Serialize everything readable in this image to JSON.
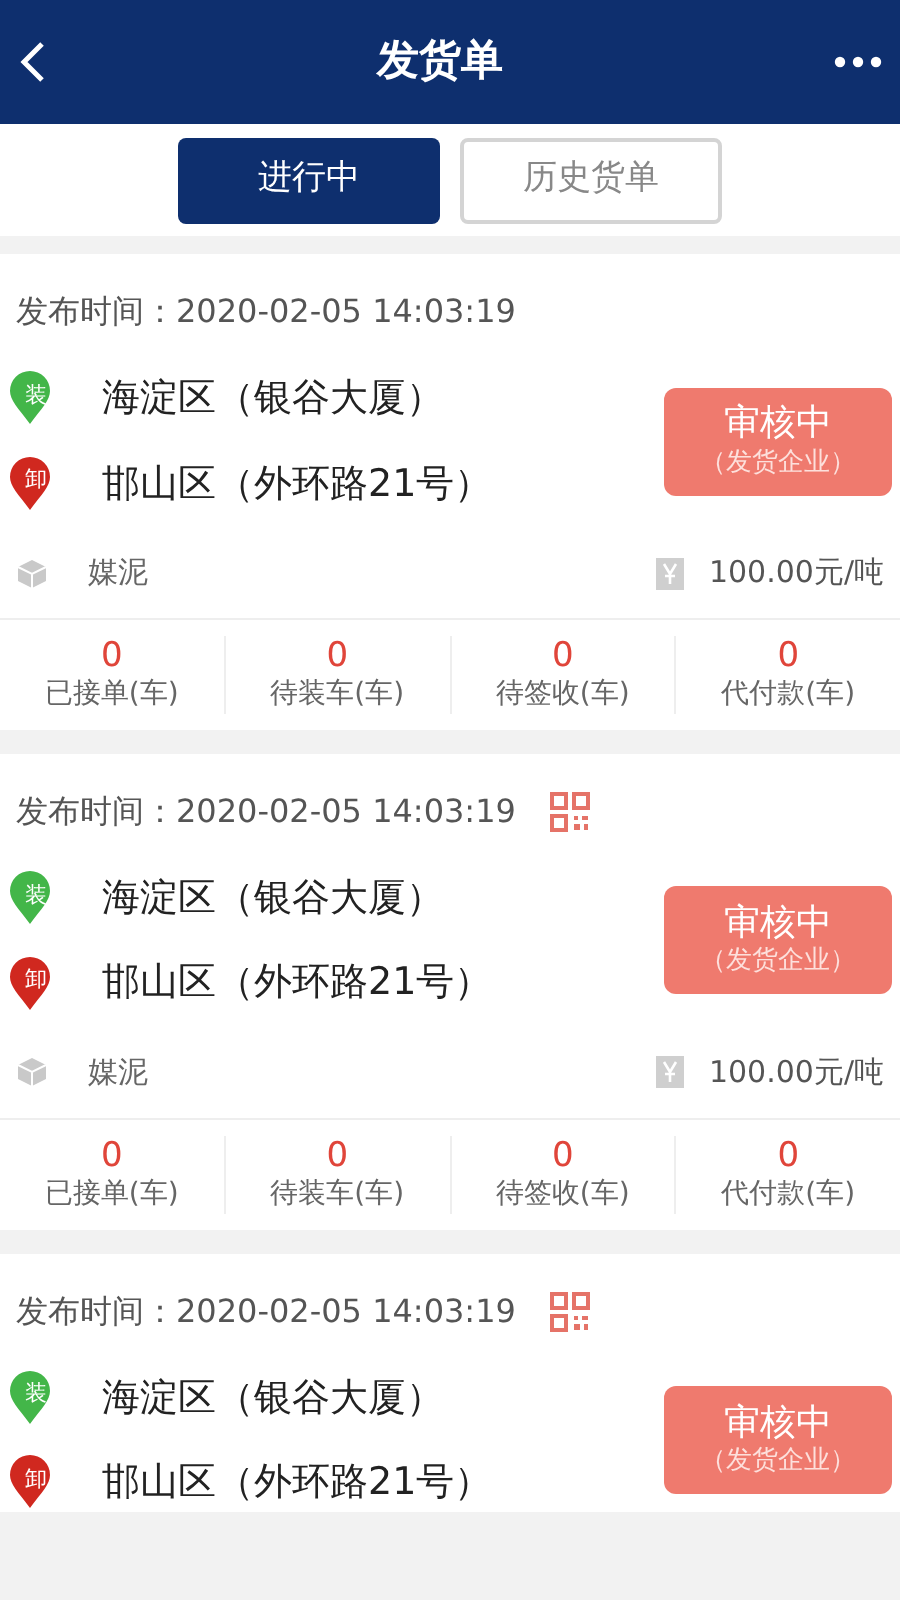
{
  "header": {
    "title": "发货单"
  },
  "tabs": [
    {
      "label": "进行中",
      "selected": true
    },
    {
      "label": "历史货单",
      "selected": false
    }
  ],
  "orders": [
    {
      "time_label": "发布时间：",
      "time": "2020-02-05 14:03:19",
      "qr": false,
      "stops": [
        {
          "pin": "装",
          "color": "#43b649",
          "address": "海淀区（银谷大厦）"
        },
        {
          "pin": "卸",
          "color": "#d0281f",
          "address": "邯山区（外环路21号）"
        }
      ],
      "status": {
        "title": "审核中",
        "subtitle": "（发货企业）"
      },
      "cargo": "媒泥",
      "price": "100.00元/吨",
      "stats": [
        {
          "value": "0",
          "label": "已接单(车)"
        },
        {
          "value": "0",
          "label": "待装车(车)"
        },
        {
          "value": "0",
          "label": "待签收(车)"
        },
        {
          "value": "0",
          "label": "代付款(车)"
        }
      ]
    },
    {
      "time_label": "发布时间：",
      "time": "2020-02-05 14:03:19",
      "qr": true,
      "stops": [
        {
          "pin": "装",
          "color": "#43b649",
          "address": "海淀区（银谷大厦）"
        },
        {
          "pin": "卸",
          "color": "#d0281f",
          "address": "邯山区（外环路21号）"
        }
      ],
      "status": {
        "title": "审核中",
        "subtitle": "（发货企业）"
      },
      "cargo": "媒泥",
      "price": "100.00元/吨",
      "stats": [
        {
          "value": "0",
          "label": "已接单(车)"
        },
        {
          "value": "0",
          "label": "待装车(车)"
        },
        {
          "value": "0",
          "label": "待签收(车)"
        },
        {
          "value": "0",
          "label": "代付款(车)"
        }
      ]
    },
    {
      "time_label": "发布时间：",
      "time": "2020-02-05 14:03:19",
      "qr": true,
      "stops": [
        {
          "pin": "装",
          "color": "#43b649",
          "address": "海淀区（银谷大厦）"
        },
        {
          "pin": "卸",
          "color": "#d0281f",
          "address": "邯山区（外环路21号）"
        }
      ],
      "status": {
        "title": "审核中",
        "subtitle": "（发货企业）"
      }
    }
  ]
}
